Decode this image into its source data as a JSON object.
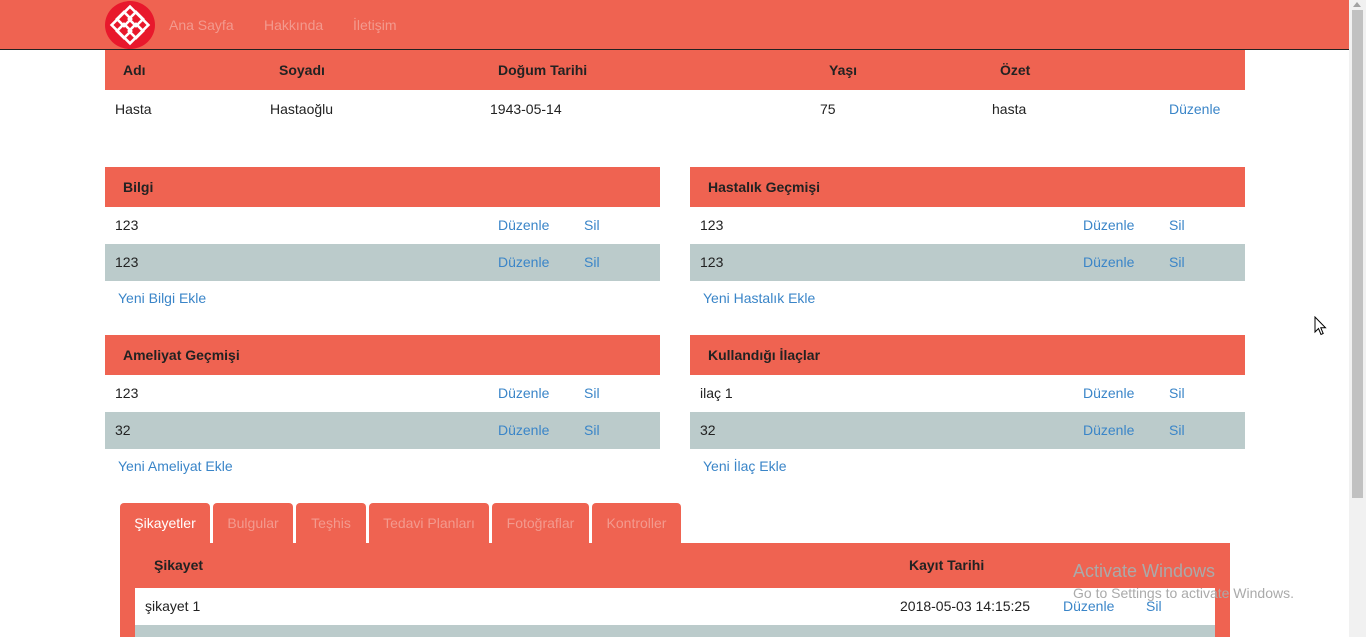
{
  "nav": {
    "links": [
      "Ana Sayfa",
      "Hakkında",
      "İletişim"
    ]
  },
  "patient": {
    "headers": [
      "Adı",
      "Soyadı",
      "Doğum Tarihi",
      "Yaşı",
      "Özet"
    ],
    "row": {
      "name": "Hasta",
      "surname": "Hastaoğlu",
      "birth_date": "1943-05-14",
      "age": "75",
      "summary": "hasta",
      "edit": "Düzenle"
    }
  },
  "panels": {
    "bilgi": {
      "title": "Bilgi",
      "rows": [
        "123",
        "123"
      ],
      "add": "Yeni Bilgi Ekle"
    },
    "hastalik": {
      "title": "Hastalık Geçmişi",
      "rows": [
        "123",
        "123"
      ],
      "add": "Yeni Hastalık Ekle"
    },
    "ameliyat": {
      "title": "Ameliyat Geçmişi",
      "rows": [
        "123",
        "32"
      ],
      "add": "Yeni Ameliyat Ekle"
    },
    "ilaclar": {
      "title": "Kullandığı İlaçlar",
      "rows": [
        "ilaç 1",
        "32"
      ],
      "add": "Yeni İlaç Ekle"
    }
  },
  "actions": {
    "edit": "Düzenle",
    "delete": "Sil"
  },
  "tabs": [
    "Şikayetler",
    "Bulgular",
    "Teşhis",
    "Tedavi Planları",
    "Fotoğraflar",
    "Kontroller"
  ],
  "complaints": {
    "headers": [
      "Şikayet",
      "Kayıt Tarihi"
    ],
    "rows": [
      {
        "text": "şikayet 1",
        "date": "2018-05-03 14:15:25"
      }
    ]
  },
  "watermark": {
    "line1": "Activate Windows",
    "line2": "Go to Settings to activate Windows."
  },
  "colors": {
    "accent": "#ef6351",
    "row_alt": "#bbcbcb",
    "link": "#3a85c8"
  }
}
